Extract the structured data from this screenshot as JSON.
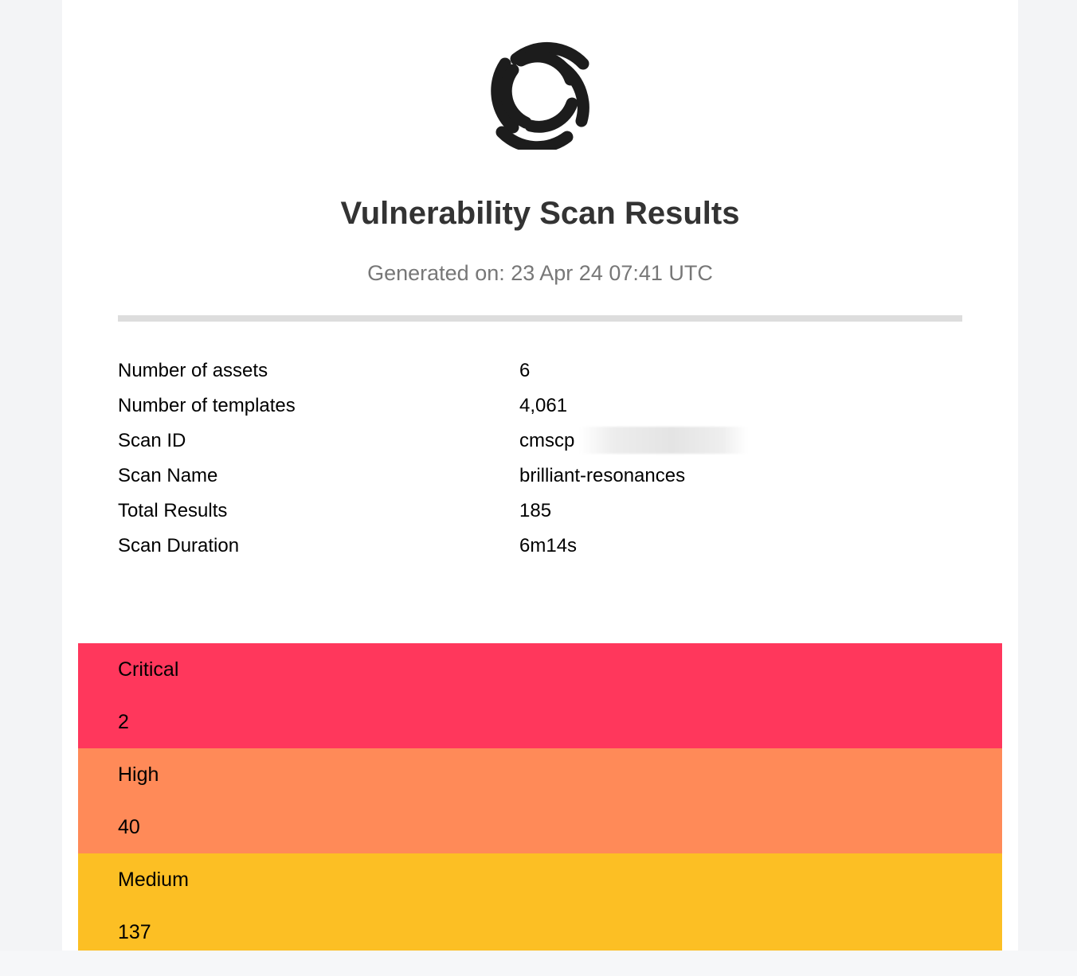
{
  "report": {
    "title": "Vulnerability Scan Results",
    "generated": "Generated on: 23 Apr 24 07:41 UTC",
    "logo_icon": "swirl-logo-icon"
  },
  "summary": [
    {
      "label": "Number of assets",
      "value": "6"
    },
    {
      "label": "Number of templates",
      "value": "4,061"
    },
    {
      "label": "Scan ID",
      "value": "cmscp"
    },
    {
      "label": "Scan Name",
      "value": "brilliant-resonances"
    },
    {
      "label": "Total Results",
      "value": "185"
    },
    {
      "label": "Scan Duration",
      "value": "6m14s"
    }
  ],
  "severity": [
    {
      "label": "Critical",
      "count": "2",
      "color": "#ff375c"
    },
    {
      "label": "High",
      "count": "40",
      "color": "#ff8a58"
    },
    {
      "label": "Medium",
      "count": "137",
      "color": "#fcbf24"
    }
  ]
}
